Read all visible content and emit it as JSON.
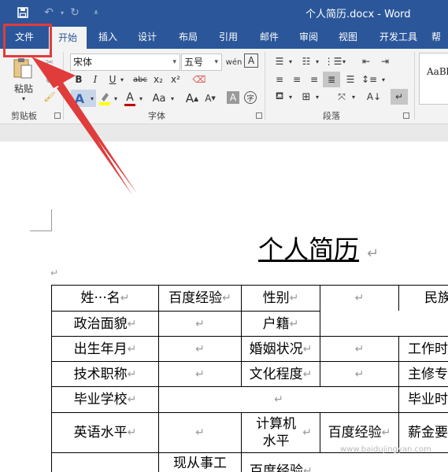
{
  "titlebar": {
    "doc_title": "个人简历.docx  -  Word",
    "save_icon": "save-icon",
    "undo_icon": "undo-icon",
    "redo_icon": "redo-icon",
    "customize_icon": "customize-qat-icon"
  },
  "tabs": [
    "文件",
    "开始",
    "插入",
    "设计",
    "布局",
    "引用",
    "邮件",
    "审阅",
    "视图",
    "开发工具",
    "帮"
  ],
  "ribbon": {
    "paste_label": "粘贴",
    "font_name": "宋体",
    "font_size": "五号",
    "groups": [
      "剪贴板",
      "字体",
      "段落"
    ],
    "format_buttons": [
      "B",
      "I",
      "U",
      "abc",
      "x₂",
      "x²"
    ],
    "font_glyphs": [
      "A",
      "A",
      "Aa",
      "A",
      "A",
      "A",
      "字"
    ],
    "style_preview": "AaBb"
  },
  "document": {
    "heading": "个人简历",
    "pilcrow": "↵",
    "rows": [
      [
        "姓···名",
        "百度经验",
        "性别",
        "",
        "民族"
      ],
      [
        "政治面貌",
        "",
        "户籍"
      ],
      [
        "出生年月",
        "",
        "婚姻状况",
        "",
        "工作时"
      ],
      [
        "技术职称",
        "",
        "文化程度",
        "",
        "主修专"
      ],
      [
        "毕业学校",
        "",
        "毕业时"
      ],
      [
        "英语水平",
        "",
        "计算机水平",
        "百度经验",
        "薪金要"
      ],
      [
        "",
        "现从事工",
        "百度经验"
      ]
    ],
    "watermark": "www.baidujingyan.com"
  },
  "colors": {
    "brand": "#2b579a",
    "highlight": "#e03c3c",
    "font_color": "#c00000",
    "highlight_color": "#ffff00"
  }
}
